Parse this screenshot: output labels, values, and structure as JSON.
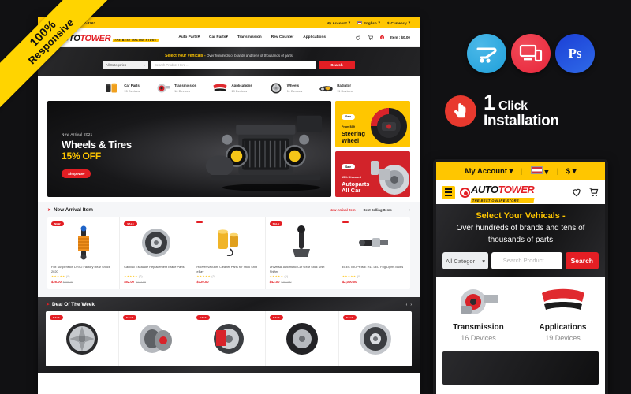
{
  "ribbon": {
    "line1": "100%",
    "line2": "Responsive"
  },
  "desktop": {
    "topbar": {
      "helpline": "Helpline: +1 (465) 557-8763",
      "account": "My Account",
      "language": "English",
      "currency": "Currency",
      "caret": "▾"
    },
    "logo": {
      "part1": "AUTO",
      "part2": "TOWER",
      "tagline": "THE BEST ONLINE STORE"
    },
    "nav": [
      {
        "label": "Auto Parts",
        "caret": "▾"
      },
      {
        "label": "Car Parts",
        "caret": "▾"
      },
      {
        "label": "Transmission",
        "caret": ""
      },
      {
        "label": "Rev Counter",
        "caret": ""
      },
      {
        "label": "Applications",
        "caret": ""
      }
    ],
    "header_right": {
      "cart_count": "0",
      "cart_label": "Item : $0.00"
    },
    "hero": {
      "title": "Select Your Vehicals -",
      "subtitle": "Over hundreds of brands and tens of thousands of parts",
      "category_select": "All Categories",
      "caret": "▾",
      "search_placeholder": "Search Product Here ...",
      "search_button": "Search"
    },
    "categories": [
      {
        "name": "Car Parts",
        "devices": "15 Devices"
      },
      {
        "name": "Transmission",
        "devices": "16 Devices"
      },
      {
        "name": "Applications",
        "devices": "19 Devices"
      },
      {
        "name": "Wheels",
        "devices": "11 Devices"
      },
      {
        "name": "Radiator",
        "devices": "11 Devices"
      }
    ],
    "big_banner": {
      "eyebrow": "New Arrival 2021",
      "title": "Wheels & Tires",
      "discount": "15% OFF",
      "button": "Shop Now"
    },
    "side_banners": [
      {
        "tag": "Sale",
        "sub": "From $99",
        "line1": "Steering",
        "line2": "Wheel"
      },
      {
        "tag": "Sale",
        "sub": "15% Discount",
        "line1": "Autoparts",
        "line2": "All Car"
      }
    ],
    "new_arrival": {
      "section_title": "New Arrival Item",
      "tab_a": "New Arrival Item",
      "tab_b": "Best Selling Items",
      "prev": "‹",
      "next": "›",
      "products": [
        {
          "tag": "NEW",
          "name": "Fox Suspension DHX2 Factory Rear Shock 2020",
          "stars": "★★★★★",
          "count": "(0)",
          "price": "$26.00",
          "old": "$241.00"
        },
        {
          "tag": "SALE",
          "name": "Cadillac Escalade Replacement Brake Parts",
          "stars": "★★★★★",
          "count": "(0)",
          "price": "$52.00",
          "old": "$122.00"
        },
        {
          "tag": "",
          "name": "Hoover Vacuum Cleaner Parts for Stick Shift  eBay",
          "stars": "★★★★★",
          "count": "(0)",
          "price": "$120.00",
          "old": ""
        },
        {
          "tag": "SALE",
          "name": "Universal Automatic Car Gear Stick Shift Shifter",
          "stars": "★★★★★",
          "count": "(0)",
          "price": "$42.00",
          "old": "$100.00"
        },
        {
          "tag": "",
          "name": "ELECTROPRIME H11 LED Fog Lights Bulbs",
          "stars": "★★★★★",
          "count": "(0)",
          "price": "$2,000.00",
          "old": ""
        }
      ]
    },
    "deal": {
      "section_title": "Deal Of The Week",
      "prev": "‹",
      "next": "›",
      "tags": [
        "SALE",
        "SALE",
        "SALE",
        "SALE",
        "SALE"
      ]
    }
  },
  "right_panel": {
    "badges": [
      {
        "name": "opencart-cart-icon",
        "color": "#1fa0da"
      },
      {
        "name": "responsive-devices-icon",
        "color": "#e8263b"
      },
      {
        "name": "photoshop-icon",
        "color": "#2f6ae8",
        "label": "Ps"
      }
    ],
    "oneclick": {
      "number": "1",
      "word1": "Click",
      "word2": "Installation"
    },
    "phone": {
      "topbar": {
        "account": "My Account",
        "caret": "▾",
        "currency": "$"
      },
      "logo": {
        "part1": "AUTO",
        "part2": "TOWER",
        "tagline": "THE BEST ONLINE STORE"
      },
      "hero": {
        "title": "Select Your Vehicals -",
        "subtitle": "Over hundreds of brands and tens of thousands of parts",
        "category_select": "All Categor",
        "caret": "▾",
        "search_placeholder": "Search Product ...",
        "search_button": "Search"
      },
      "categories": [
        {
          "name": "Transmission",
          "devices": "16 Devices"
        },
        {
          "name": "Applications",
          "devices": "19 Devices"
        }
      ]
    }
  }
}
